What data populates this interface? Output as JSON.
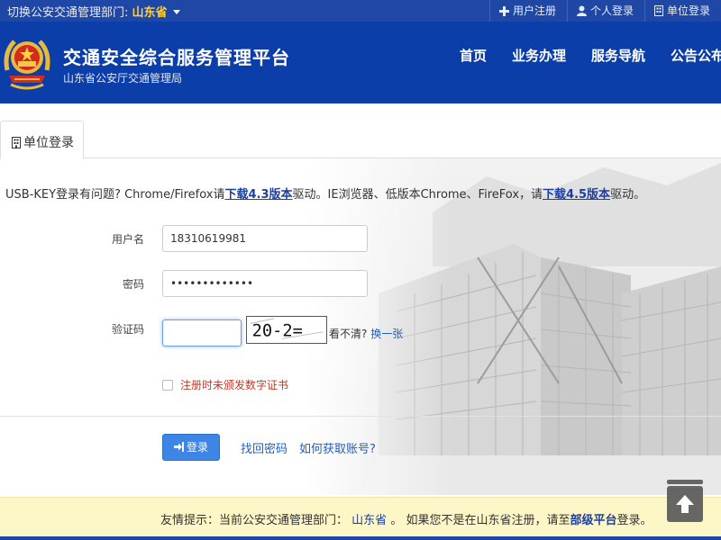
{
  "topbar": {
    "switch_label": "切换公安交通管理部门:",
    "province": "山东省",
    "links": [
      {
        "icon": "plus-icon",
        "label": "用户注册"
      },
      {
        "icon": "user-icon",
        "label": "个人登录"
      },
      {
        "icon": "building-icon",
        "label": "单位登录"
      }
    ]
  },
  "header": {
    "title": "交通安全综合服务管理平台",
    "subtitle": "山东省公安厅交通管理局",
    "nav": [
      "首页",
      "业务办理",
      "服务导航",
      "公告公布"
    ]
  },
  "tabs": {
    "active": "单位登录",
    "active_icon": "building-icon"
  },
  "notice": {
    "prefix": "USB-KEY登录有问题? Chrome/Firefox请",
    "link1": "下载4.3版本",
    "middle": "驱动。IE浏览器、低版本Chrome、FireFox，请",
    "link2": "下载4.5版本",
    "suffix": "驱动。"
  },
  "form": {
    "username_label": "用户名",
    "username_value": "18310619981",
    "password_label": "密码",
    "password_value": "•••••••••••••",
    "captcha_label": "验证码",
    "captcha_value": "",
    "captcha_image_text": "20-2=",
    "captcha_hint": "看不清?",
    "captcha_refresh": "换一张",
    "cert_checkbox_label": "注册时未颁发数字证书",
    "login_button": "登录",
    "forgot_password": "找回密码",
    "get_account": "如何获取账号?"
  },
  "tip": {
    "prefix": "友情提示：当前公安交通管理部门：",
    "province": "山东省",
    "middle": "。 如果您不是在山东省注册，请至",
    "link": "部级平台",
    "suffix": "登录。"
  },
  "colors": {
    "header_bg": "#0b3ea8",
    "topbar_bg": "#1f47a6",
    "province_highlight": "#ffd23f",
    "link_blue": "#1d5fc4",
    "button_blue": "#3d86e6",
    "tip_bg": "#fdf6c6",
    "cert_red": "#c0392b"
  }
}
